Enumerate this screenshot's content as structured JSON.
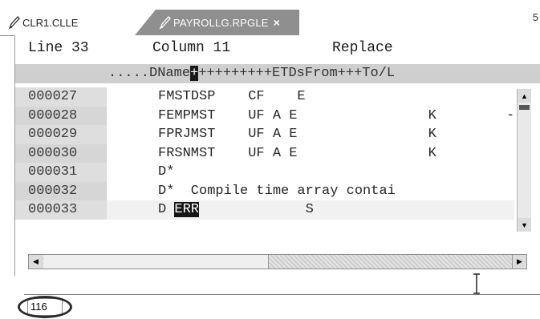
{
  "tabs": [
    {
      "label": "CLR1.CLLE",
      "active": false
    },
    {
      "label": "PAYROLLG.RPGLE",
      "active": true,
      "close": "×"
    }
  ],
  "view_menu": "5",
  "status": {
    "line": "Line 33",
    "column": "Column 11",
    "mode": "Replace"
  },
  "ruler": {
    "before": ".....DName",
    "cursor": "+",
    "after": "+++++++++ETDsFrom+++To/L"
  },
  "rows": [
    {
      "seq": "000027",
      "text": "FMSTDSP    CF    E",
      "suffix": ""
    },
    {
      "seq": "000028",
      "text": "FEMPMST    UF A E                K",
      "suffix": "-"
    },
    {
      "seq": "000029",
      "text": "FPRJMST    UF A E                K",
      "suffix": ""
    },
    {
      "seq": "000030",
      "text": "FRSNMST    UF A E                K",
      "suffix": ""
    },
    {
      "seq": "000031",
      "text": "D*",
      "suffix": ""
    },
    {
      "seq": "000032",
      "text": "D*  Compile time array contai",
      "suffix": ""
    },
    {
      "seq": "000033",
      "pre": "D ",
      "highlight": "ERR",
      "post": "             S",
      "suffix": ""
    }
  ],
  "command_line": {
    "value": "116"
  },
  "colors": {
    "active_tab": "#8f8f8f",
    "ruler_bg": "#cfcfcf",
    "seq_bg": "#d6d6d6",
    "highlight": "#151515"
  }
}
